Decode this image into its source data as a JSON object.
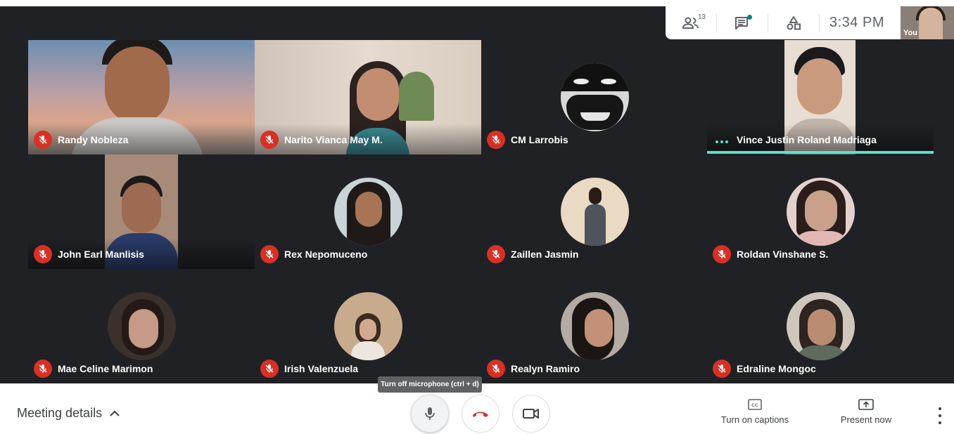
{
  "topbar": {
    "participants_count": "13",
    "time": "3:34 PM",
    "self_label": "You"
  },
  "participants": [
    {
      "name": "Randy Nobleza",
      "mic_off": true,
      "video": true
    },
    {
      "name": "Narito Vianca May M.",
      "mic_off": true,
      "video": true
    },
    {
      "name": "CM Larrobis",
      "mic_off": true,
      "video": false
    },
    {
      "name": "Vince Justin Roland Madriaga",
      "mic_off": false,
      "speaking": true,
      "video": true
    },
    {
      "name": "John Earl Manlisis",
      "mic_off": true,
      "video": true
    },
    {
      "name": "Rex Nepomuceno",
      "mic_off": true,
      "video": false
    },
    {
      "name": "Zaillen Jasmin",
      "mic_off": true,
      "video": false
    },
    {
      "name": "Roldan Vinshane S.",
      "mic_off": true,
      "video": false
    },
    {
      "name": "Mae Celine Marimon",
      "mic_off": true,
      "video": false
    },
    {
      "name": "Irish Valenzuela",
      "mic_off": true,
      "video": false
    },
    {
      "name": "Realyn Ramiro",
      "mic_off": true,
      "video": false
    },
    {
      "name": "Edraline Mongoc",
      "mic_off": true,
      "video": false
    }
  ],
  "bottombar": {
    "meeting_details": "Meeting details",
    "tooltip": "Turn off microphone (ctrl + d)",
    "captions_label": "Turn on captions",
    "present_label": "Present now"
  },
  "colors": {
    "stage_bg": "#202124",
    "tile_bg": "#3c4043",
    "mic_off_red": "#d93025",
    "speaking_accent": "#5ae0c9",
    "chat_dot": "#00897b"
  }
}
